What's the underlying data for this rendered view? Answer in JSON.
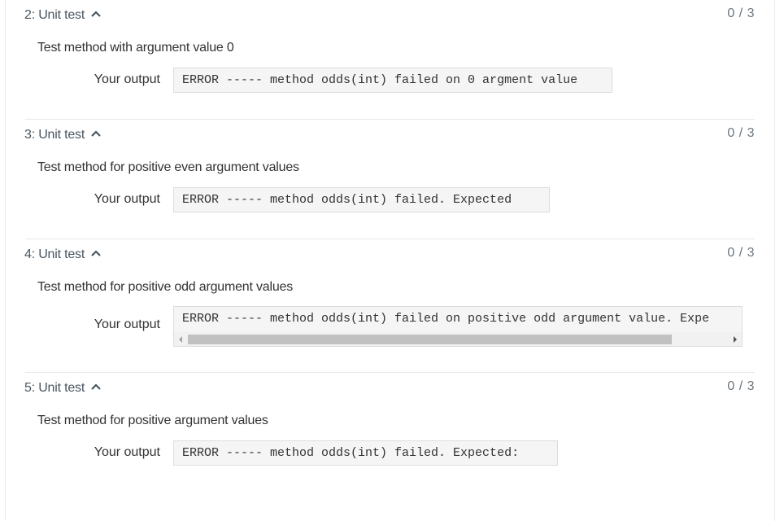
{
  "tests": [
    {
      "title": "2: Unit test",
      "score": "0 / 3",
      "description": "Test method with argument value 0",
      "output_label": "Your output",
      "output": "ERROR ----- method odds(int) failed on 0 argment value",
      "has_scrollbar": false
    },
    {
      "title": "3: Unit test",
      "score": "0 / 3",
      "description": "Test method for positive even argument values",
      "output_label": "Your output",
      "output": "ERROR ----- method odds(int) failed. Expected",
      "has_scrollbar": false
    },
    {
      "title": "4: Unit test",
      "score": "0 / 3",
      "description": "Test method for positive odd argument values",
      "output_label": "Your output",
      "output": "ERROR ----- method odds(int) failed on positive odd argument value. Expe",
      "has_scrollbar": true
    },
    {
      "title": "5: Unit test",
      "score": "0 / 3",
      "description": "Test method for positive argument values",
      "output_label": "Your output",
      "output": "ERROR ----- method odds(int) failed. Expected:",
      "has_scrollbar": false
    }
  ],
  "icons": {
    "collapse": "chevron-up-icon",
    "scroll_left": "scroll-left-arrow-icon",
    "scroll_right": "scroll-right-arrow-icon"
  },
  "colors": {
    "header_text": "#4a5660",
    "score_text": "#6b757d",
    "output_bg": "#f5f5f5",
    "output_border": "#dcdcdc",
    "divider": "#e8e8e8"
  }
}
